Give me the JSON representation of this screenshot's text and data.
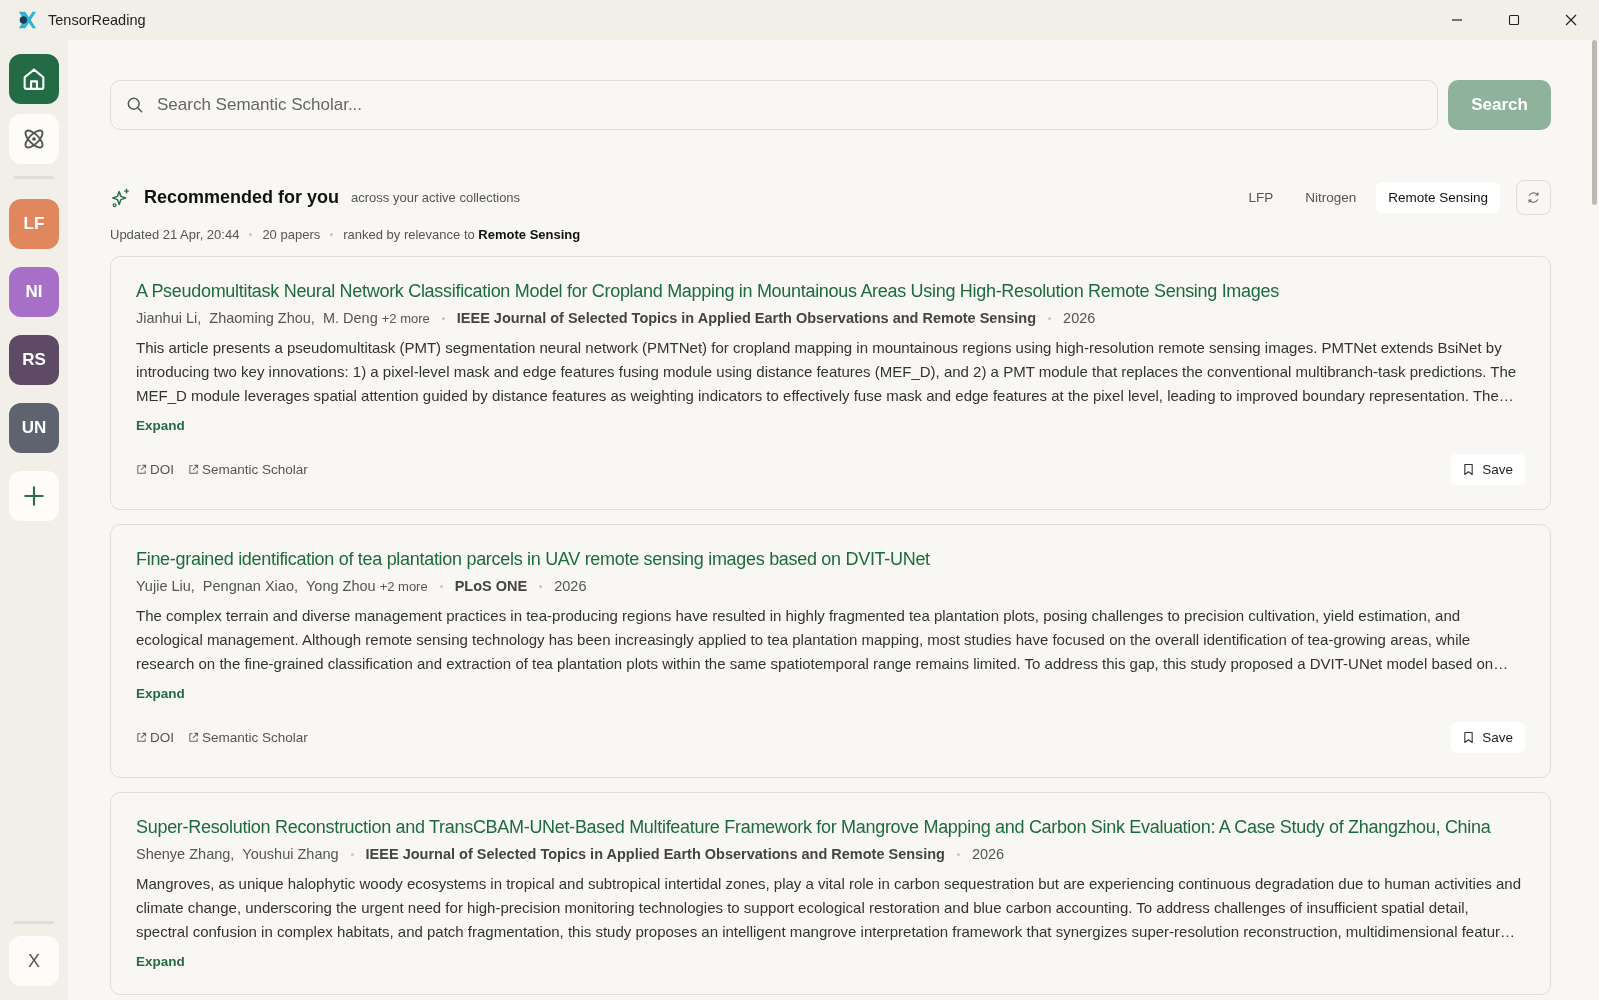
{
  "window": {
    "title": "TensorReading"
  },
  "sidebar": {
    "nav": [
      {
        "kind": "home",
        "selected": true
      },
      {
        "kind": "atom",
        "selected": false
      }
    ],
    "collections": [
      {
        "label": "LF",
        "color": "#e0875e",
        "selected": false
      },
      {
        "label": "NI",
        "color": "#a86fc8",
        "selected": false
      },
      {
        "label": "RS",
        "color": "#5f4a66",
        "selected": false
      },
      {
        "label": "UN",
        "color": "#5d6470",
        "selected": false
      }
    ],
    "footer": {
      "label": "X"
    }
  },
  "search": {
    "placeholder": "Search Semantic Scholar...",
    "button": "Search",
    "disabled": true
  },
  "recommended": {
    "title": "Recommended for you",
    "subtitle": "across your active collections",
    "filters": [
      {
        "label": "LFP",
        "selected": false
      },
      {
        "label": "Nitrogen",
        "selected": false
      },
      {
        "label": "Remote Sensing",
        "selected": true
      }
    ],
    "meta": [
      "Updated 21 Apr, 20:44",
      "20 papers"
    ],
    "ranked_prefix": "ranked by relevance to",
    "ranked_topic": "Remote Sensing"
  },
  "papers": [
    {
      "title": "A Pseudomultitask Neural Network Classification Model for Cropland Mapping in Mountainous Areas Using High-Resolution Remote Sensing Images",
      "authors": [
        "Jianhui Li,",
        "Zhaoming Zhou,",
        "M. Deng"
      ],
      "more": "+2 more",
      "venue": "IEEE Journal of Selected Topics in Applied Earth Observations and Remote Sensing",
      "year": "2026",
      "abstract": "This article presents a pseudomultitask (PMT) segmentation neural network (PMTNet) for cropland mapping in mountainous regions using high-resolution remote sensing images. PMTNet extends BsiNet by introducing two key innovations: 1) a pixel-level mask and edge features fusing module using distance features (MEF_D), and 2) a PMT module that replaces the conventional multibranch-task predictions. The MEF_D module leverages spatial attention guided by distance features as weighting indicators to effectively fuse mask and edge features at the pixel level, leading to improved boundary representation. The…",
      "expand": "Expand",
      "links": [
        "DOI",
        "Semantic Scholar"
      ],
      "save": "Save"
    },
    {
      "title": "Fine-grained identification of tea plantation parcels in UAV remote sensing images based on DVIT-UNet",
      "authors": [
        "Yujie Liu,",
        "Pengnan Xiao,",
        "Yong Zhou"
      ],
      "more": "+2 more",
      "venue": "PLoS ONE",
      "year": "2026",
      "abstract": "The complex terrain and diverse management practices in tea-producing regions have resulted in highly fragmented tea plantation plots, posing challenges to precision cultivation, yield estimation, and ecological management. Although remote sensing technology has been increasingly applied to tea plantation mapping, most studies have focused on the overall identification of tea-growing areas, while research on the fine-grained classification and extraction of tea plantation plots within the same spatiotemporal range remains limited. To address this gap, this study proposed a DVIT-UNet model based on…",
      "expand": "Expand",
      "links": [
        "DOI",
        "Semantic Scholar"
      ],
      "save": "Save"
    },
    {
      "title": "Super-Resolution Reconstruction and TransCBAM-UNet-Based Multifeature Framework for Mangrove Mapping and Carbon Sink Evaluation: A Case Study of Zhangzhou, China",
      "authors": [
        "Shenye Zhang,",
        "Youshui Zhang"
      ],
      "venue": "IEEE Journal of Selected Topics in Applied Earth Observations and Remote Sensing",
      "year": "2026",
      "abstract": "Mangroves, as unique halophytic woody ecosystems in tropical and subtropical intertidal zones, play a vital role in carbon sequestration but are experiencing continuous degradation due to human activities and climate change, underscoring the urgent need for high-precision monitoring technologies to support ecological restoration and blue carbon accounting. To address challenges of insufficient spatial detail, spectral confusion in complex habitats, and patch fragmentation, this study proposes an intelligent mangrove interpretation framework that synergizes super-resolution reconstruction, multidimensional featur…",
      "expand": "Expand"
    }
  ]
}
